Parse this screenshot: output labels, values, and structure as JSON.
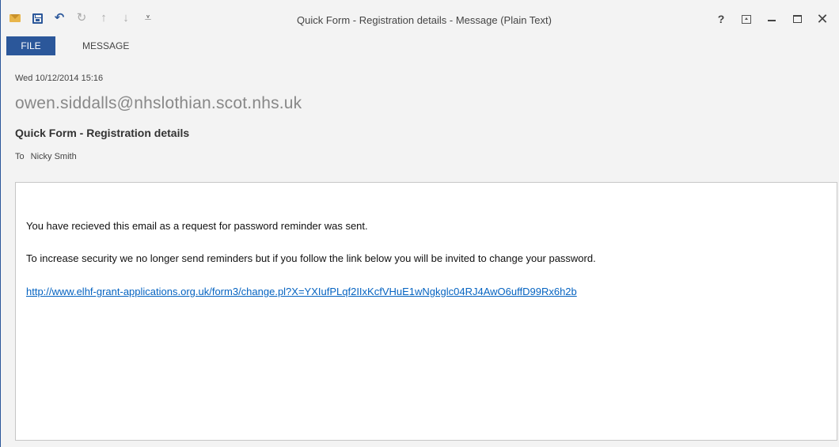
{
  "window": {
    "title": "Quick Form - Registration details - Message (Plain Text)",
    "accent_color": "#2b579a"
  },
  "quick_access": {
    "icons": [
      "mail-icon",
      "save-icon",
      "undo-icon",
      "redo-icon",
      "previous-item-icon",
      "next-item-icon",
      "customize-toolbar-icon"
    ],
    "undo_glyph": "↶",
    "redo_glyph": "↻",
    "up_glyph": "↑",
    "down_glyph": "↓",
    "customize_glyph": "⩡"
  },
  "controls": {
    "help": "?",
    "minimize": "",
    "close": "✕"
  },
  "ribbon": {
    "tabs": [
      {
        "label": "FILE",
        "active": true
      },
      {
        "label": "MESSAGE",
        "active": false
      }
    ]
  },
  "message": {
    "date": "Wed 10/12/2014 15:16",
    "sender": "owen.siddalls@nhslothian.scot.nhs.uk",
    "subject": "Quick Form - Registration details",
    "to_label": "To",
    "to_value": "Nicky Smith",
    "body": {
      "line1": "You have recieved this email as a request for password reminder was sent.",
      "line2": "To increase security we no longer send reminders but if you follow the link below you will be invited to change your password.",
      "link": "http://www.elhf-grant-applications.org.uk/form3/change.pl?X=YXIufPLqf2IIxKcfVHuE1wNgkglc04RJ4AwO6uffD99Rx6h2b"
    }
  }
}
